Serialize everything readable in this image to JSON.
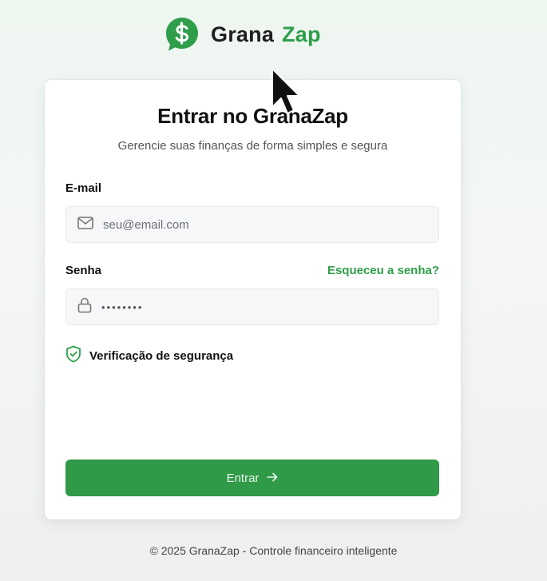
{
  "brand": {
    "name_part1": "Grana",
    "name_part2": "Zap",
    "logo_icon": "dollar-chat-bubble-icon",
    "color": "#2e9e4a"
  },
  "login": {
    "title": "Entrar no GranaZap",
    "subtitle": "Gerencie suas finanças de forma simples e segura",
    "email_label": "E-mail",
    "email_placeholder": "seu@email.com",
    "email_icon": "mail-icon",
    "password_label": "Senha",
    "forgot_link": "Esqueceu a senha?",
    "password_value": "••••••••",
    "password_icon": "lock-icon",
    "security_label": "Verificação de segurança",
    "security_icon": "shield-check-icon",
    "submit_label": "Entrar",
    "submit_icon": "arrow-right-icon"
  },
  "footer": {
    "text": "© 2025 GranaZap - Controle financeiro inteligente"
  },
  "colors": {
    "accent": "#2e9e4a",
    "button": "#2f9a47",
    "input_bg": "#f6f7f8"
  }
}
